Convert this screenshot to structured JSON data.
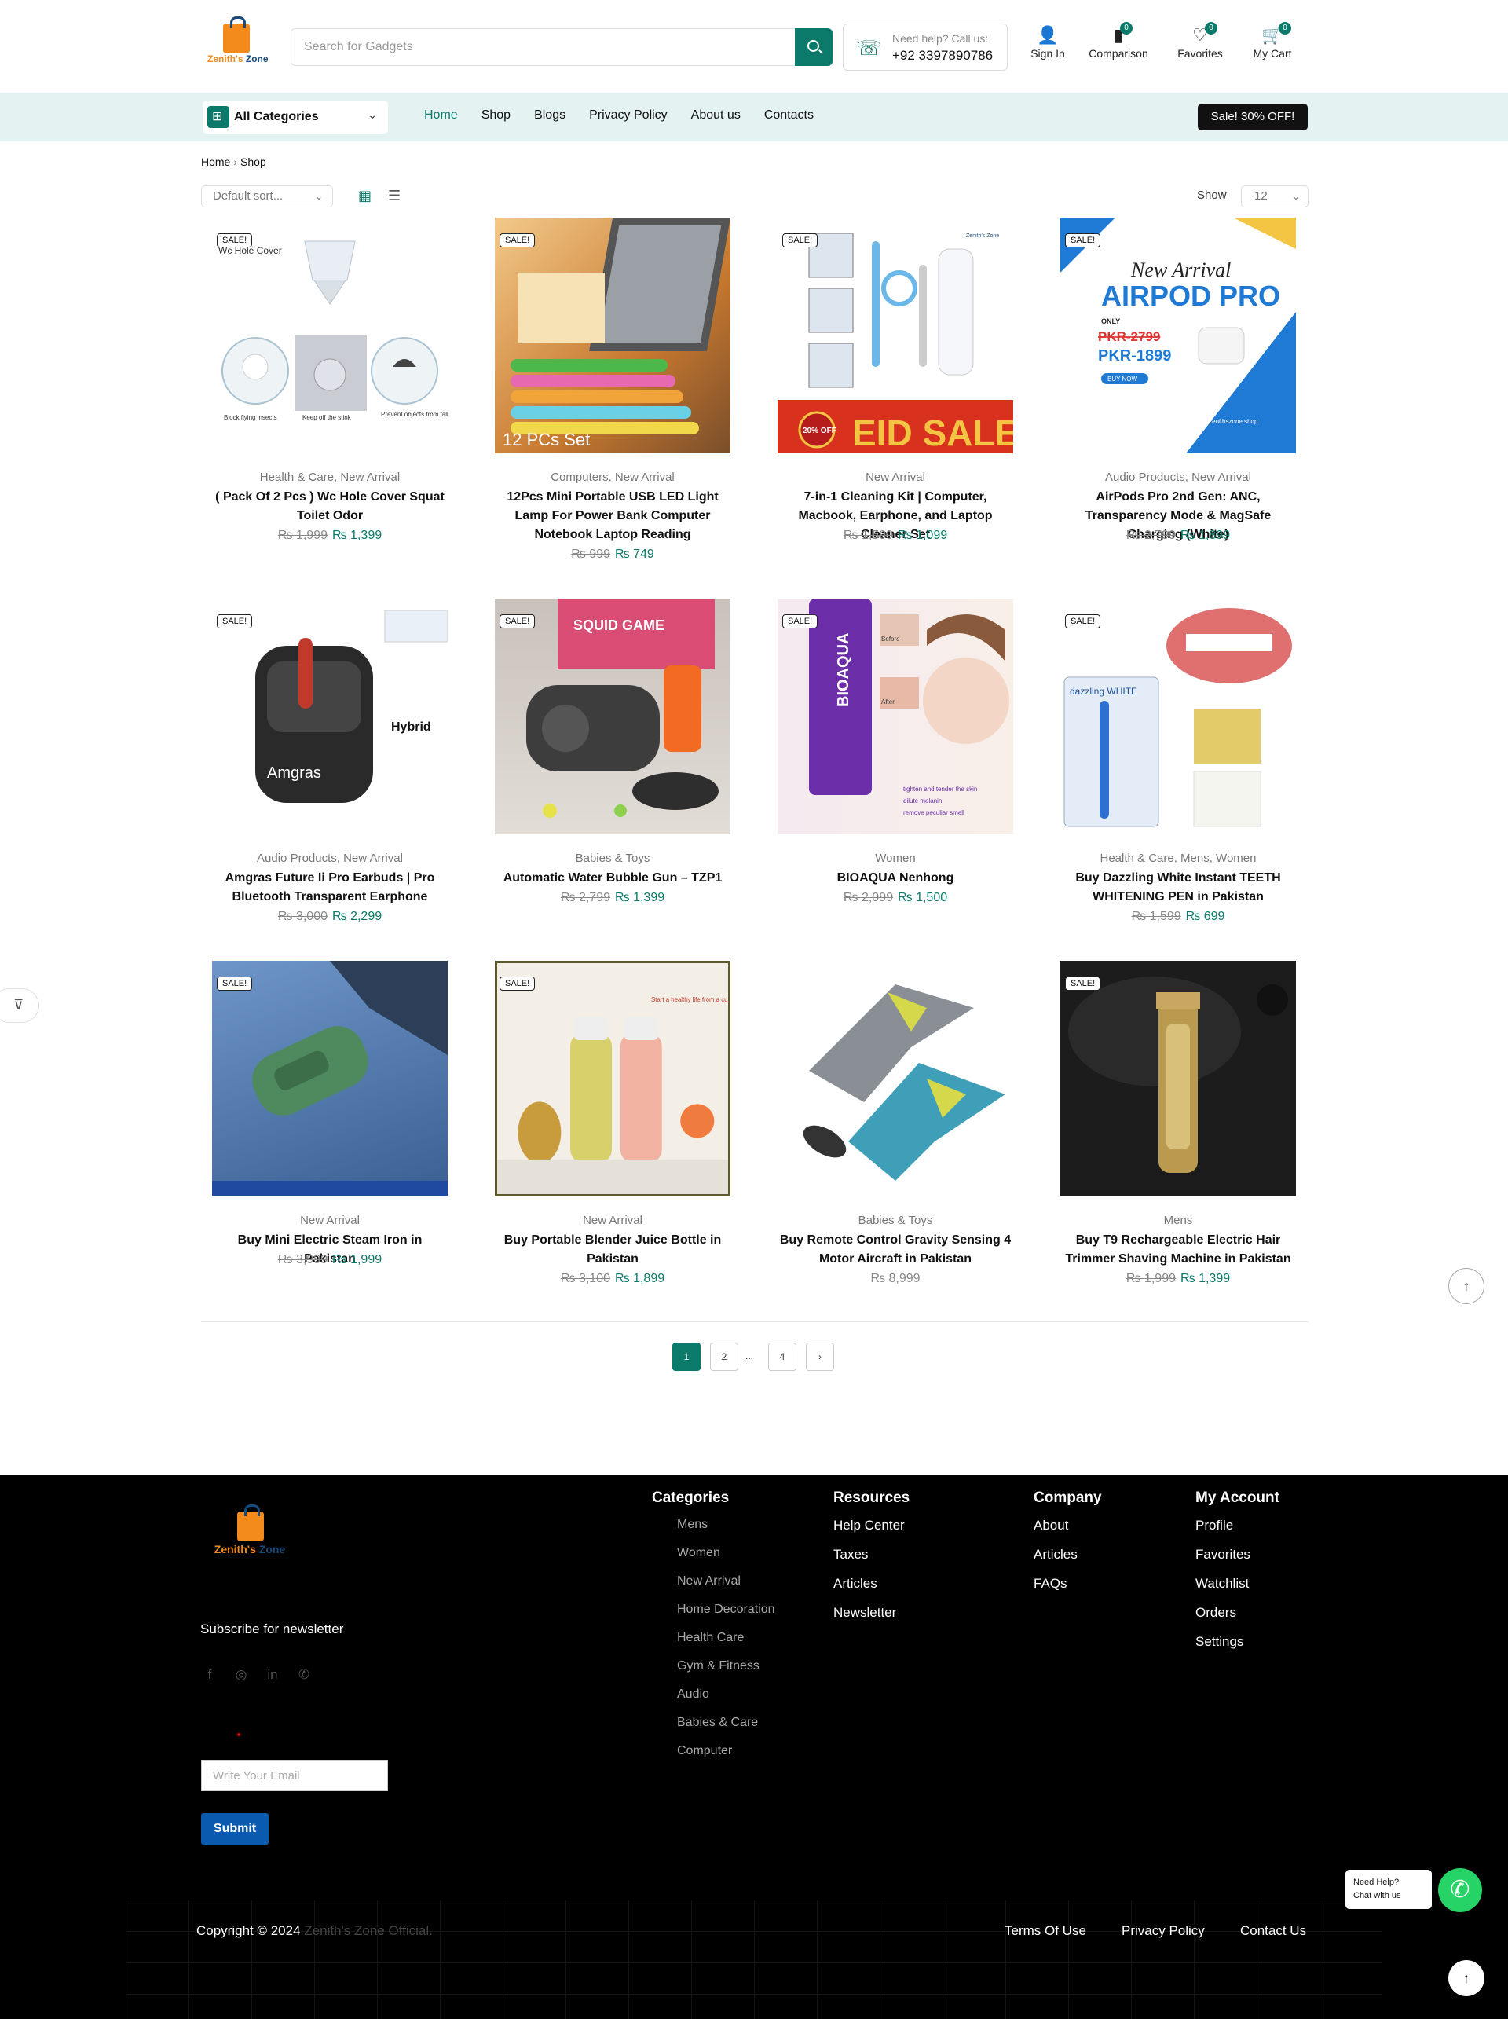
{
  "header": {
    "logo_text_a": "Zenith's",
    "logo_text_b": "Zone",
    "search_placeholder": "Search for Gadgets",
    "help_line1": "Need help? Call us:",
    "help_phone": "+92 3397890786",
    "icons": [
      {
        "label": "Sign In",
        "icon": "user-icon",
        "badge": ""
      },
      {
        "label": "Comparison",
        "icon": "bar-chart-icon",
        "badge": "0"
      },
      {
        "label": "Favorites",
        "icon": "heart-icon",
        "badge": "0"
      },
      {
        "label": "My Cart",
        "icon": "cart-icon",
        "badge": "0"
      }
    ]
  },
  "nav": {
    "all_categories": "All Categories",
    "links": [
      "Home",
      "Shop",
      "Blogs",
      "Privacy Policy",
      "About us",
      "Contacts"
    ],
    "sale_label": "Sale! 30% OFF!"
  },
  "breadcrumb": [
    "Home",
    "Shop"
  ],
  "toolbar": {
    "sort": "Default sort...",
    "show_label": "Show",
    "show_value": "12"
  },
  "products": [
    {
      "cat": "Health & Care, New Arrival",
      "name": "( Pack Of 2 Pcs ) Wc Hole Cover Squat Toilet Odor",
      "old": "₨ 1,999",
      "new": "₨ 1,399",
      "sale": "SALE!"
    },
    {
      "cat": "Computers, New Arrival",
      "name": "12Pcs Mini Portable USB LED Light Lamp For Power Bank Computer Notebook Laptop Reading",
      "old": "₨ 999",
      "new": "₨ 749",
      "sale": "SALE!"
    },
    {
      "cat": "New Arrival",
      "name": "7-in-1 Cleaning Kit | Computer, Macbook, Earphone, and Laptop Cleaner Set",
      "old": "₨ 1,599",
      "new": "₨ 1,099",
      "sale": "SALE!"
    },
    {
      "cat": "Audio Products, New Arrival",
      "name": "AirPods Pro 2nd Gen: ANC, Transparency Mode & MagSafe Charging (White)",
      "old": "₨ 2,799",
      "new": "₨ 1,899",
      "sale": "SALE!"
    },
    {
      "cat": "Audio Products, New Arrival",
      "name": "Amgras Future Ii Pro Earbuds | Pro Bluetooth Transparent Earphone",
      "old": "₨ 3,000",
      "new": "₨ 2,299",
      "sale": "SALE!"
    },
    {
      "cat": "Babies & Toys",
      "name": "Automatic Water Bubble Gun – TZP1",
      "old": "₨ 2,799",
      "new": "₨ 1,399",
      "sale": "SALE!"
    },
    {
      "cat": "Women",
      "name": "BIOAQUA Nenhong",
      "old": "₨ 2,099",
      "new": "₨ 1,500",
      "sale": "SALE!"
    },
    {
      "cat": "Health & Care, Mens, Women",
      "name": "Buy Dazzling White Instant TEETH WHITENING PEN in Pakistan",
      "old": "₨ 1,599",
      "new": "₨ 699",
      "sale": "SALE!"
    },
    {
      "cat": "New Arrival",
      "name": "Buy Mini Electric Steam Iron in Pakistan",
      "old": "₨ 3,999",
      "new": "₨ 1,999",
      "sale": "SALE!"
    },
    {
      "cat": "New Arrival",
      "name": "Buy Portable Blender Juice Bottle in Pakistan",
      "old": "₨ 3,100",
      "new": "₨ 1,899",
      "sale": "SALE!"
    },
    {
      "cat": "Babies & Toys",
      "name": "Buy Remote Control Gravity Sensing 4 Motor Aircraft in Pakistan",
      "old": "",
      "new": "₨ 8,999",
      "sale": ""
    },
    {
      "cat": "Mens",
      "name": "Buy T9 Rechargeable Electric Hair Trimmer Shaving Machine in Pakistan",
      "old": "₨ 1,999",
      "new": "₨ 1,399",
      "sale": "SALE!"
    }
  ],
  "image_texts": {
    "p1_top": "Wc Hole Cover",
    "p1_caps": [
      "Block flying insects",
      "Keep off the stink",
      "Prevent objects from falling"
    ],
    "p2_caption": "12 PCs Set",
    "p3_banner": "EID SALE",
    "p3_badge": "20% OFF",
    "p3_brand": "Zenith's Zone",
    "p4_line1": "New Arrival",
    "p4_line2": "AIRPOD PRO",
    "p4_only": "ONLY",
    "p4_old": "PKR-2799",
    "p4_new": "PKR-1899",
    "p4_buy": "BUY NOW",
    "p4_url": "www.zenithszone.shop",
    "p5_brand": "Amgras",
    "p5_hybrid": "Hybrid",
    "p6_text": "SQUID GAME",
    "p7_brand": "BIOAQUA",
    "p7_before": "Before",
    "p7_after": "After",
    "p7_bullets": [
      "tighten and tender the skin",
      "dilute melanin",
      "remove peculiar smell"
    ],
    "p8_brand": "dazzling WHITE",
    "p10_text": "Start a healthy life from a cup of fresh juice"
  },
  "pagination": [
    "1",
    "2",
    "...",
    "4",
    "›"
  ],
  "footer": {
    "logo_a": "Zenith's",
    "logo_b": "Zone",
    "subscribe": "Subscribe for newsletter",
    "email_placeholder": "Write Your Email",
    "submit": "Submit",
    "categories_title": "Categories",
    "categories": [
      "Mens",
      "Women",
      "New Arrival",
      "Home Decoration",
      "Health Care",
      "Gym & Fitness",
      "Audio",
      "Babies & Care",
      "Computer"
    ],
    "resources_title": "Resources",
    "resources": [
      "Help Center",
      "Taxes",
      "Articles",
      "Newsletter"
    ],
    "company_title": "Company",
    "company": [
      "About",
      "Articles",
      "FAQs"
    ],
    "account_title": "My Account",
    "account": [
      "Profile",
      "Favorites",
      "Watchlist",
      "Orders",
      "Settings"
    ],
    "copyright": "Copyright © 2024",
    "copyright_brand": "Zenith's Zone Official.",
    "bottom_links": [
      "Terms Of Use",
      "Privacy Policy",
      "Contact Us"
    ],
    "need_help": "Need Help?",
    "chat": "Chat with us"
  },
  "colors": {
    "accent": "#0b7a6a",
    "nav_bg": "#e4f3f1",
    "footer_bg": "#000000",
    "submit": "#0a5bb0",
    "whatsapp": "#25d366"
  }
}
